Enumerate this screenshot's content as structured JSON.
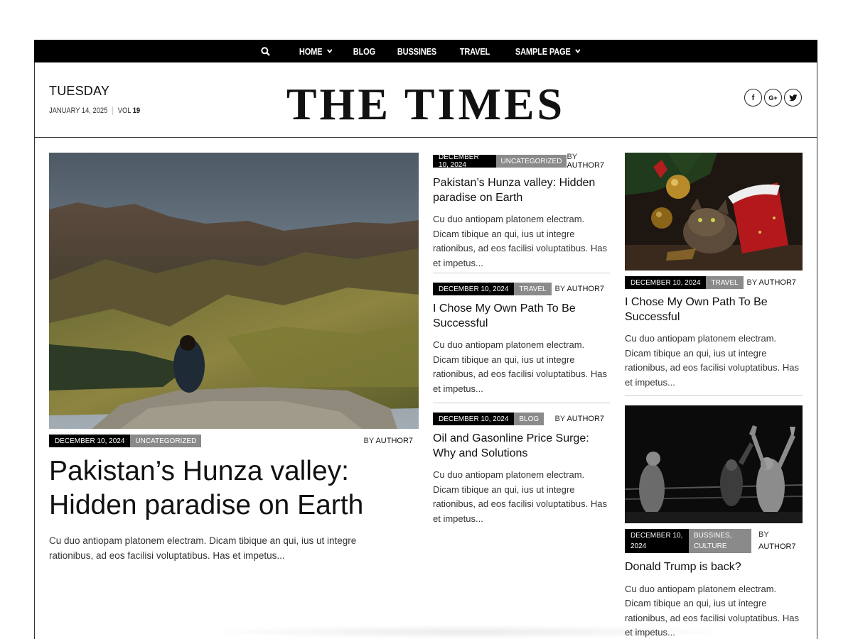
{
  "nav": {
    "search_icon": "search-icon",
    "items": [
      {
        "label": "HOME",
        "dropdown": true
      },
      {
        "label": "BLOG",
        "dropdown": false
      },
      {
        "label": "BUSSINES",
        "dropdown": false
      },
      {
        "label": "TRAVEL",
        "dropdown": false
      },
      {
        "label": "SAMPLE PAGE",
        "dropdown": true
      }
    ]
  },
  "masthead": {
    "day": "TUESDAY",
    "date": "JANUARY 14, 2025",
    "vol_label": "VOL",
    "vol_number": "19",
    "logo": "THE TIMES",
    "social": [
      "f",
      "G+",
      "t"
    ]
  },
  "hero": {
    "date": "DECEMBER 10, 2024",
    "category": "UNCATEGORIZED",
    "by": "BY",
    "author": "AUTHOR7",
    "title": "Pakistan’s Hunza valley: Hidden paradise on Earth",
    "excerpt": "Cu duo antiopam platonem electram. Dicam tibique an qui, ius ut integre rationibus, ad eos facilisi voluptatibus. Has et impetus..."
  },
  "middle": [
    {
      "date": "DECEMBER 10, 2024",
      "category": "UNCATEGORIZED",
      "by": "BY",
      "author": "AUTHOR7",
      "title": "Pakistan’s Hunza valley: Hidden paradise on Earth",
      "excerpt": "Cu duo antiopam platonem electram. Dicam tibique an qui, ius ut integre rationibus, ad eos facilisi voluptatibus. Has et impetus..."
    },
    {
      "date": "DECEMBER 10, 2024",
      "category": "TRAVEL",
      "by": "BY",
      "author": "AUTHOR7",
      "title": "I Chose My Own Path To Be Successful",
      "excerpt": "Cu duo antiopam platonem electram. Dicam tibique an qui, ius ut integre rationibus, ad eos facilisi voluptatibus. Has et impetus..."
    },
    {
      "date": "DECEMBER 10, 2024",
      "category": "BLOG",
      "by": "BY",
      "author": "AUTHOR7",
      "title": "Oil and Gasonline Price Surge: Why and Solutions",
      "excerpt": "Cu duo antiopam platonem electram. Dicam tibique an qui, ius ut integre rationibus, ad eos facilisi voluptatibus. Has et impetus..."
    }
  ],
  "right": [
    {
      "date": "DECEMBER 10, 2024",
      "category": "TRAVEL",
      "by": "BY",
      "author": "AUTHOR7",
      "title": "I Chose My Own Path To Be Successful",
      "excerpt": "Cu duo antiopam platonem electram. Dicam tibique an qui, ius ut integre rationibus, ad eos facilisi voluptatibus. Has et impetus..."
    },
    {
      "date_line1": "DECEMBER 10,",
      "date_line2": "2024",
      "category_line1": "BUSSINES,",
      "category_line2": "CULTURE",
      "by": "BY",
      "author": "AUTHOR7",
      "title": "Donald Trump is back?",
      "excerpt": "Cu duo antiopam platonem electram. Dicam tibique an qui, ius ut integre rationibus, ad eos facilisi voluptatibus. Has et impetus..."
    }
  ],
  "colors": {
    "nav_bg": "#000000",
    "badge_date": "#000000",
    "badge_category": "#8a8a8a"
  }
}
